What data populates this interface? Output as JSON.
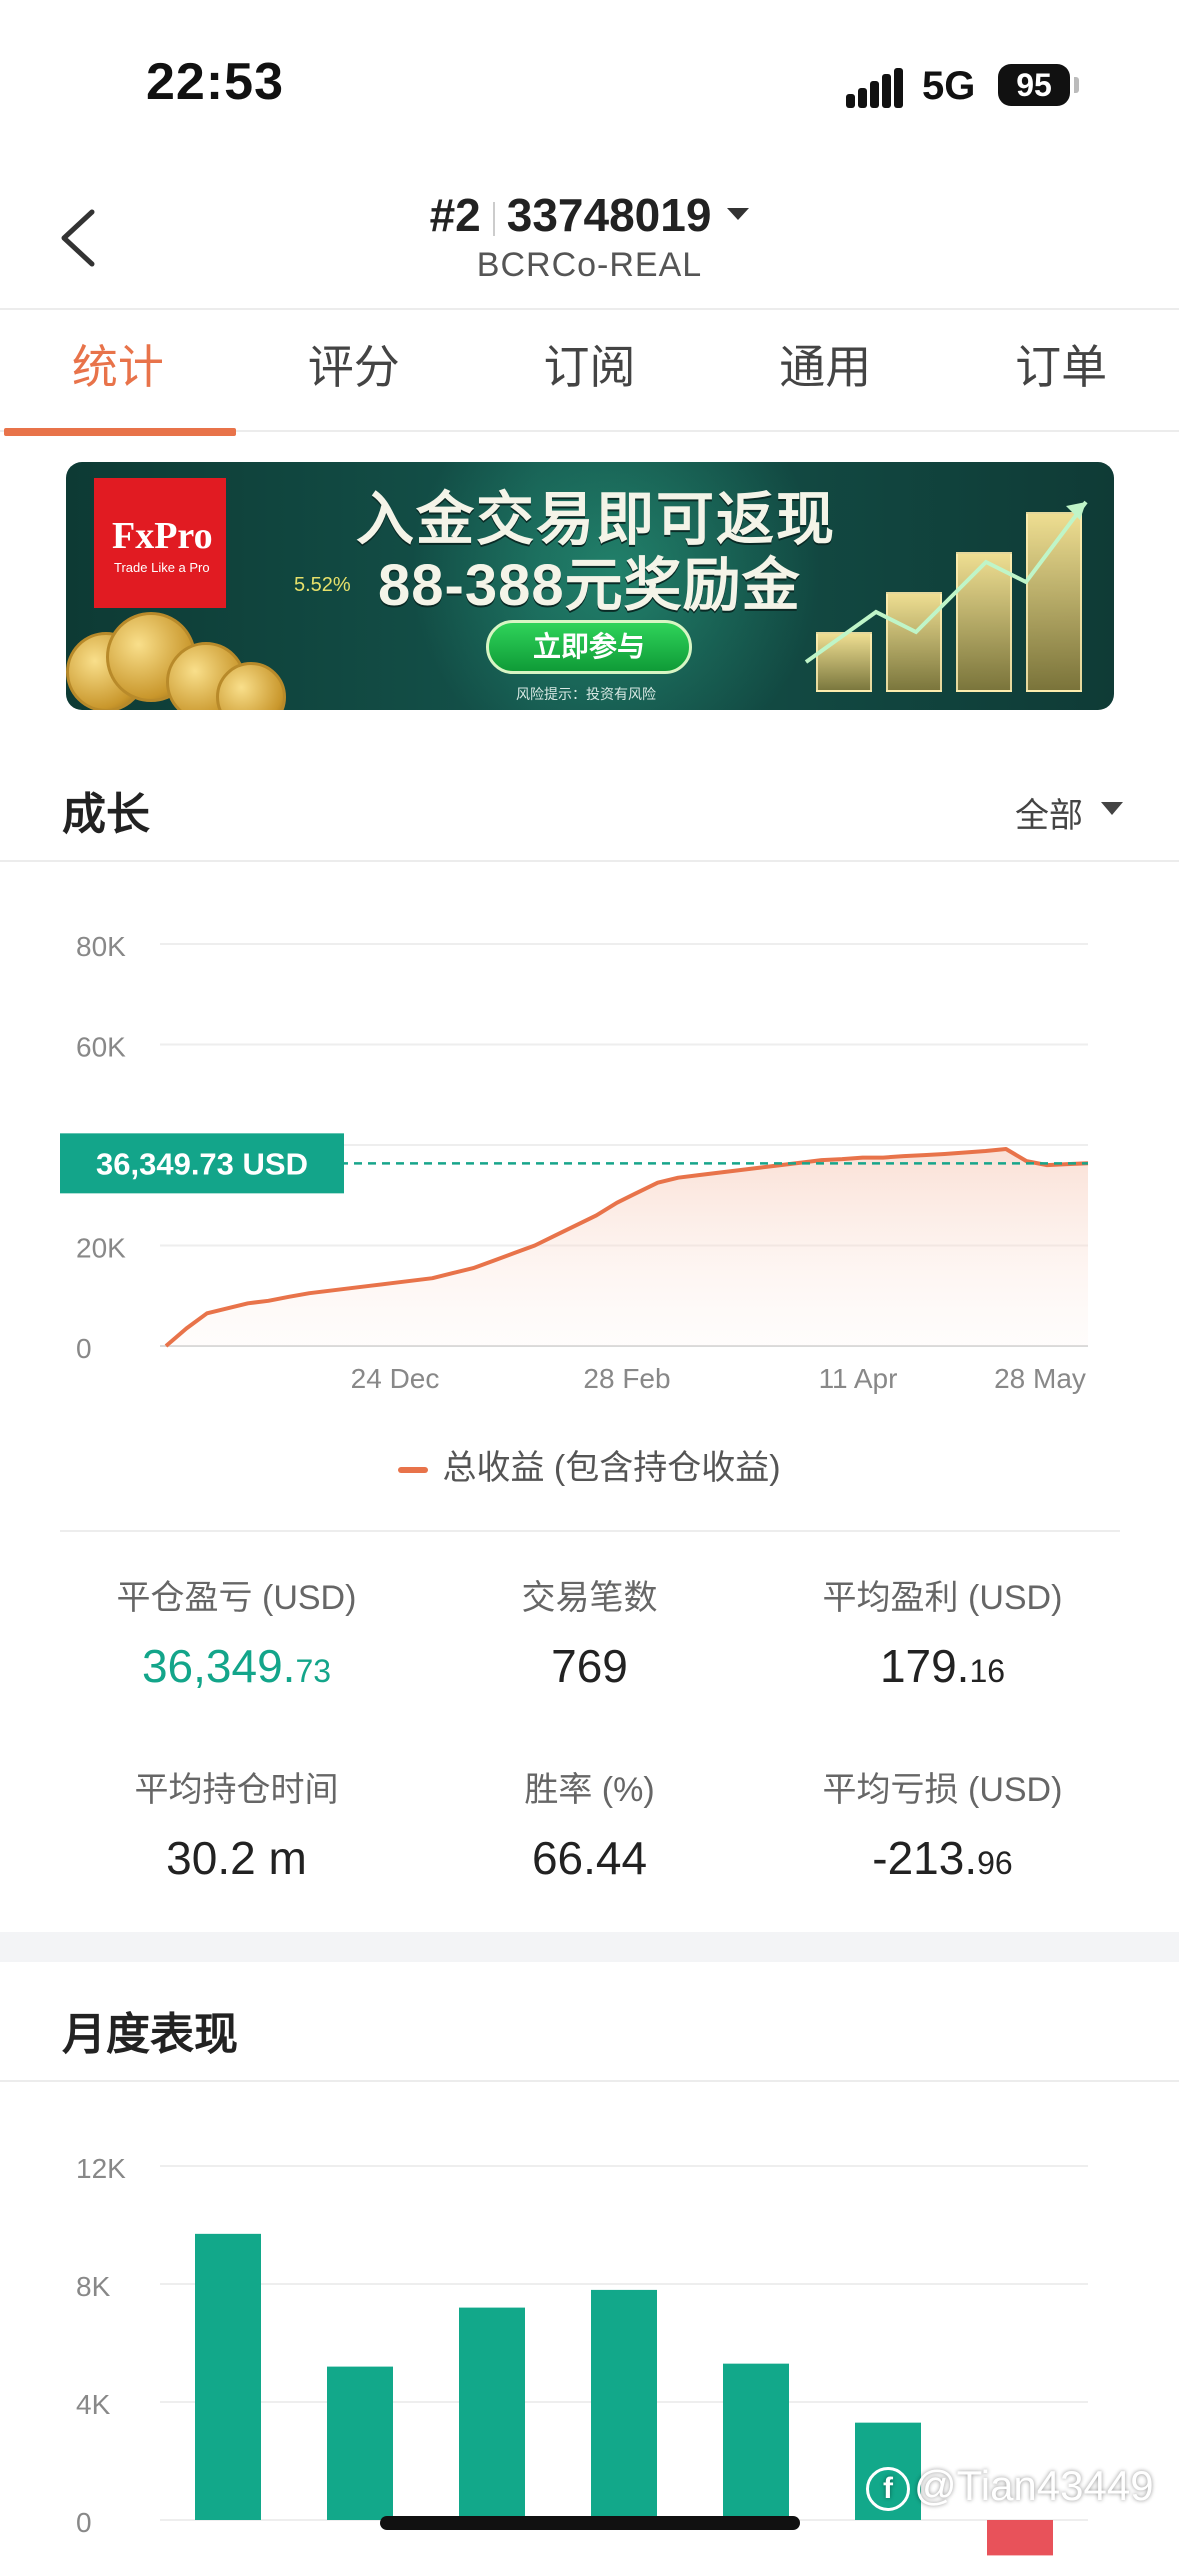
{
  "status_bar": {
    "time": "22:53",
    "network": "5G",
    "battery": "95"
  },
  "header": {
    "account_index": "#2",
    "account_number": "33748019",
    "server": "BCRCo-REAL"
  },
  "tabs": [
    {
      "label": "统计",
      "active": true
    },
    {
      "label": "评分",
      "active": false
    },
    {
      "label": "订阅",
      "active": false
    },
    {
      "label": "通用",
      "active": false
    },
    {
      "label": "订单",
      "active": false
    }
  ],
  "banner": {
    "brand": "FxPro",
    "brand_tagline": "Trade Like a Pro",
    "headline_1": "入金交易即可返现",
    "headline_2": "88-388元奖励金",
    "button": "立即参与",
    "risk_note": "风险提示：投资有风险",
    "small_stat": "5.52%"
  },
  "growth": {
    "title": "成长",
    "filter": "全部",
    "current_label": "36,349.73 USD",
    "legend": "总收益 (包含持仓收益)"
  },
  "chart_data": [
    {
      "type": "area",
      "title": "",
      "ylim": [
        0,
        80000
      ],
      "y_ticks": [
        "80K",
        "60K",
        "40K",
        "20K",
        "0"
      ],
      "x_ticks": [
        "24 Dec",
        "28 Feb",
        "11 Apr",
        "28 May"
      ],
      "series": [
        {
          "name": "总收益 (包含持仓收益)",
          "color": "#e8734a",
          "values": [
            0,
            3500,
            6500,
            7500,
            8500,
            9000,
            9800,
            10500,
            11000,
            11500,
            12000,
            12500,
            13000,
            13500,
            14500,
            15500,
            17000,
            18500,
            20000,
            22000,
            24000,
            26000,
            28500,
            30500,
            32500,
            33500,
            34000,
            34500,
            35000,
            35500,
            36000,
            36500,
            37000,
            37200,
            37500,
            37500,
            37800,
            38000,
            38200,
            38500,
            38800,
            39200,
            36800,
            36000,
            36200,
            36349.73
          ]
        }
      ],
      "reference_value": 36349.73
    },
    {
      "type": "bar",
      "title": "",
      "ylim": [
        0,
        12000
      ],
      "y_ticks": [
        "12K",
        "8K",
        "4K",
        "0"
      ],
      "series": [
        {
          "name": "",
          "values": [
            9700,
            5200,
            7200,
            7800,
            5300,
            3300,
            -1200
          ]
        }
      ],
      "positive_color": "#12a88a",
      "negative_color": "#e8525a"
    }
  ],
  "stats": [
    {
      "label": "平仓盈亏 (USD)",
      "value_main": "36,349.",
      "value_small": "73",
      "highlight": true
    },
    {
      "label": "交易笔数",
      "value_main": "769",
      "value_small": ""
    },
    {
      "label": "平均盈利 (USD)",
      "value_main": "179.",
      "value_small": "16"
    },
    {
      "label": "平均持仓时间",
      "value_main": "30.2 m",
      "value_small": ""
    },
    {
      "label": "胜率 (%)",
      "value_main": "66.44",
      "value_small": ""
    },
    {
      "label": "平均亏损 (USD)",
      "value_main": "-213.",
      "value_small": "96"
    }
  ],
  "monthly": {
    "title": "月度表现"
  },
  "watermark": "@Tian43449"
}
